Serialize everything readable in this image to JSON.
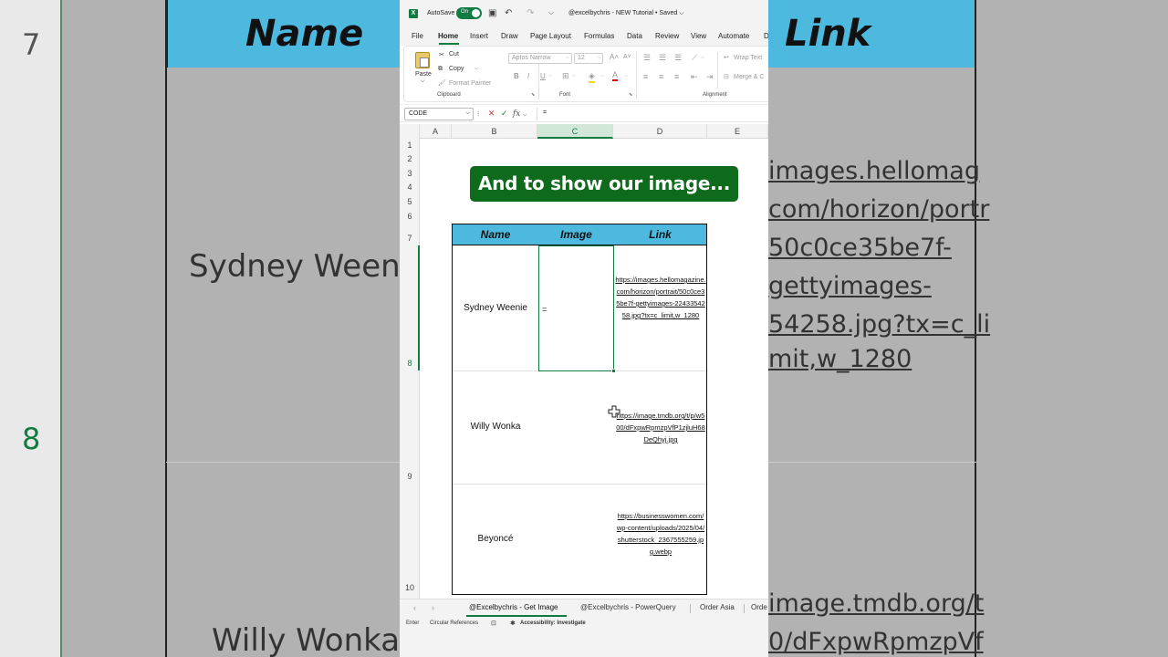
{
  "app": {
    "autosave_label": "AutoSave",
    "autosave_state": "On",
    "doc_title": "@excelbychris - NEW Tutorial • Saved ⌵"
  },
  "menu": {
    "items": [
      "File",
      "Home",
      "Insert",
      "Draw",
      "Page Layout",
      "Formulas",
      "Data",
      "Review",
      "View",
      "Automate",
      "D"
    ],
    "active": "Home"
  },
  "ribbon": {
    "clipboard": {
      "paste": "Paste",
      "cut": "Cut",
      "copy": "Copy",
      "format_painter": "Format Painter",
      "group_label": "Clipboard"
    },
    "font": {
      "font_name": "Aptos Narrow",
      "font_size": "12",
      "bold": "B",
      "italic": "I",
      "underline": "U",
      "group_label": "Font"
    },
    "alignment": {
      "wrap_text": "Wrap Text",
      "merge": "Merge & C",
      "group_label": "Alignment"
    }
  },
  "formula_bar": {
    "name_box": "CODE",
    "formula": "="
  },
  "columns": [
    "A",
    "B",
    "C",
    "D",
    "E"
  ],
  "selected_column": "C",
  "rows": [
    "1",
    "2",
    "3",
    "4",
    "5",
    "6",
    "7",
    "8",
    "9",
    "10"
  ],
  "selected_row": "8",
  "banner": "And to show our image...",
  "table": {
    "headers": [
      "Name",
      "Image",
      "Link"
    ],
    "rows": [
      {
        "name": "Sydney Weenie",
        "image": "=",
        "link": "https://images.hellomagazine.com/horizon/portrait/50c0ce35be7f-gettyimages-2243354258.jpg?tx=c_limit,w_1280"
      },
      {
        "name": "Willy Wonka",
        "image": "",
        "link": "https://image.tmdb.org/t/p/w500/dFxpwRpmzpVfP1zjluH68DeQhyj.jpg"
      },
      {
        "name": "Beyoncé",
        "image": "",
        "link": "https://businesswomen.com/wp-content/uploads/2025/04/shutterstock_2367555259.jpg.webp"
      }
    ]
  },
  "sheet_tabs": {
    "tabs": [
      "@Excelbychris - Get Image",
      "@Excelbychris - PowerQuery",
      "Order Asia",
      "Orde"
    ],
    "active": "@Excelbychris - Get Image"
  },
  "status_bar": {
    "mode": "Enter",
    "circular": "Circular References",
    "accessibility": "Accessibility: Investigate"
  },
  "background": {
    "row7": "7",
    "row8": "8",
    "header_name": "Name",
    "header_link": "Link",
    "name1": "Sydney Weeni",
    "name2": "Willy Wonka",
    "link_lines_top": [
      "images.hellomag",
      "com/horizon/portr",
      "50c0ce35be7f-",
      "gettyimages-",
      "54258.jpg?tx=c_li",
      "mit,w_1280"
    ],
    "link_lines_bottom": [
      "image.tmdb.org/t",
      "0/dFxpwRpmzpVf"
    ]
  },
  "colors": {
    "excel_green": "#107c41",
    "banner_green": "#0e6b1c",
    "table_header": "#4db9df"
  }
}
